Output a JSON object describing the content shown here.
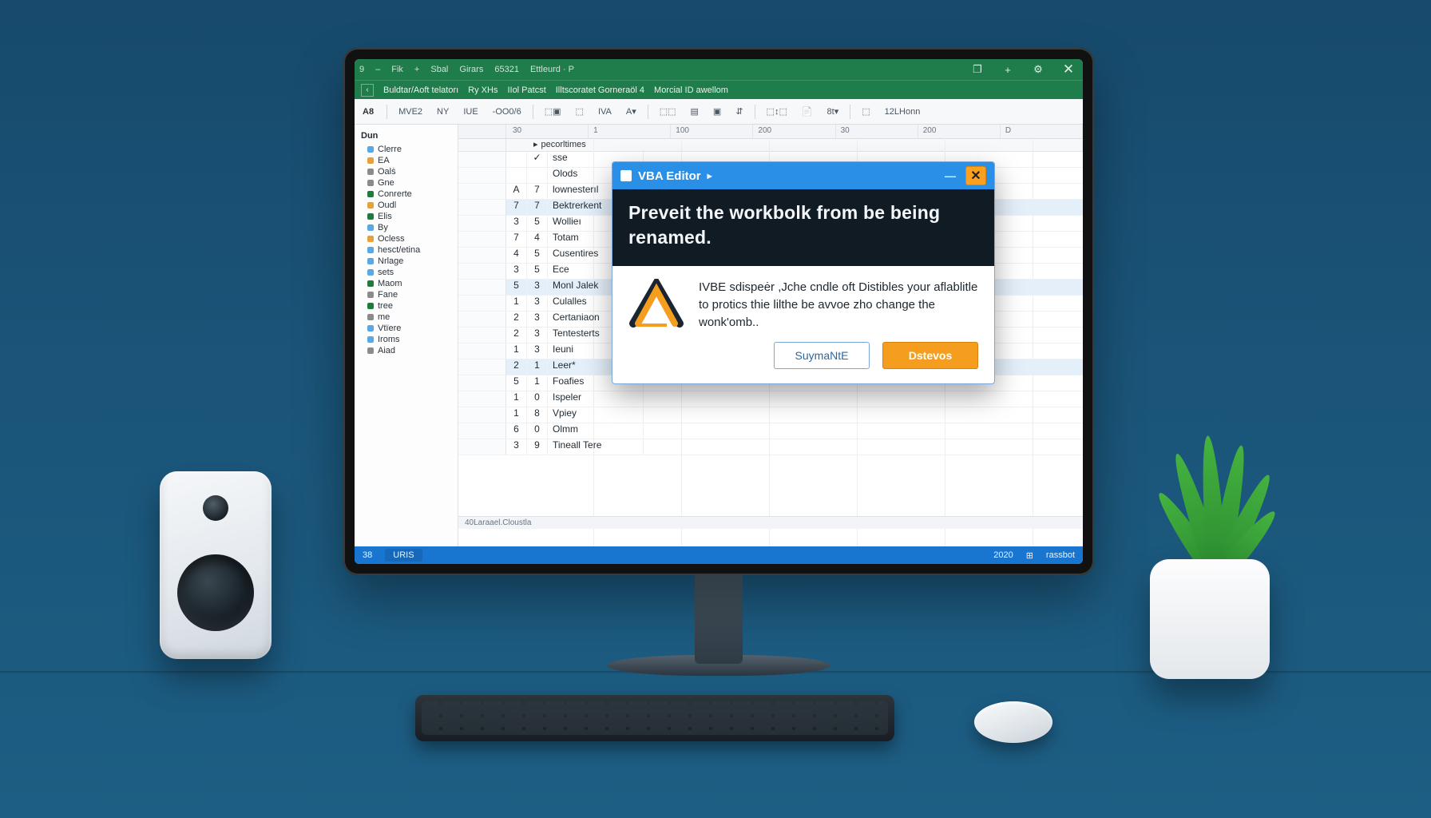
{
  "titlebar": {
    "items": [
      "9",
      "–",
      "Fik",
      "+",
      "Sbal",
      "Girars",
      "65321",
      "Ettleurd · P"
    ],
    "win": {
      "restore": "❐",
      "plus": "+",
      "gear": "⚙",
      "close": "✕"
    }
  },
  "menubar": {
    "items": [
      "Buldtar/Aoft telatorı",
      "Ry XHs",
      "IIol Patcst",
      "Illtscoratet Gorneraöl 4",
      "Morcial ID awellom"
    ]
  },
  "toolbar": {
    "left": "A8",
    "btns": [
      "MVE2",
      "NY",
      "IUE",
      "-OO0/6",
      "⬚▣",
      "⬚",
      "IVA",
      "A▾",
      "⬚⬚",
      "▤",
      "▣",
      "⇵",
      "⬚↕⬚",
      "📄",
      "8t▾",
      "⬚",
      "12LHonn"
    ]
  },
  "left": {
    "head": "Dun",
    "items": [
      {
        "c": "#5aa9e6",
        "t": "Clerre"
      },
      {
        "c": "#e8a13a",
        "t": "EA"
      },
      {
        "c": "#8b8b8b",
        "t": "Oalṡ"
      },
      {
        "c": "#8b8b8b",
        "t": "Gne"
      },
      {
        "c": "#1f7a3e",
        "t": "Conrerte"
      },
      {
        "c": "#e8a13a",
        "t": "Oudl"
      },
      {
        "c": "#1f7a3e",
        "t": "Elis"
      },
      {
        "c": "#5aa9e6",
        "t": "By"
      },
      {
        "c": "#e8a13a",
        "t": "Ocless"
      },
      {
        "c": "#5aa9e6",
        "t": "hesct/etina"
      },
      {
        "c": "#5aa9e6",
        "t": "Nrlage"
      },
      {
        "c": "#5aa9e6",
        "t": "sets"
      },
      {
        "c": "#1f7a3e",
        "t": "Maom"
      },
      {
        "c": "#8b8b8b",
        "t": "Fane"
      },
      {
        "c": "#1f7a3e",
        "t": "tree"
      },
      {
        "c": "#8b8b8b",
        "t": "me"
      },
      {
        "c": "#5aa9e6",
        "t": "Vtïere"
      },
      {
        "c": "#5aa9e6",
        "t": "Iroms"
      },
      {
        "c": "#8b8b8b",
        "t": "Aiad"
      }
    ]
  },
  "ruler": {
    "nums": [
      "30",
      "1",
      "100",
      "200",
      "30",
      "200",
      "D"
    ]
  },
  "grid": {
    "head_label": "pecorltimes",
    "rows": [
      {
        "hl": false,
        "a": "",
        "b": "✓",
        "n": "",
        "t": "sse"
      },
      {
        "hl": false,
        "a": "",
        "b": "",
        "n": "",
        "t": "Olods"
      },
      {
        "hl": false,
        "a": "A",
        "b": "7",
        "n": "",
        "t": "lownesterıl"
      },
      {
        "hl": true,
        "a": "7",
        "b": "7",
        "n": "",
        "t": "Bektrerkent"
      },
      {
        "hl": false,
        "a": "3",
        "b": "5",
        "n": "",
        "t": "Wollieı"
      },
      {
        "hl": false,
        "a": "7",
        "b": "4",
        "n": "",
        "t": "Totam"
      },
      {
        "hl": false,
        "a": "4",
        "b": "5",
        "n": "",
        "t": "Cusentires"
      },
      {
        "hl": false,
        "a": "3",
        "b": "5",
        "n": "",
        "t": "Ece"
      },
      {
        "hl": true,
        "a": "5",
        "b": "3",
        "n": "",
        "t": "Monl Jalek"
      },
      {
        "hl": false,
        "a": "1",
        "b": "3",
        "n": "",
        "t": "Culalles"
      },
      {
        "hl": false,
        "a": "2",
        "b": "3",
        "n": "",
        "t": "Certaniaon"
      },
      {
        "hl": false,
        "a": "2",
        "b": "3",
        "n": "",
        "t": "Tentesterts"
      },
      {
        "hl": false,
        "a": "1",
        "b": "3",
        "n": "",
        "t": "Ieuni"
      },
      {
        "hl": true,
        "a": "2",
        "b": "1",
        "n": "",
        "t": "Leer*"
      },
      {
        "hl": false,
        "a": "5",
        "b": "1",
        "n": "",
        "t": "Foafies"
      },
      {
        "hl": false,
        "a": "1",
        "b": "0",
        "n": "",
        "t": "Ispeler"
      },
      {
        "hl": false,
        "a": "1",
        "b": "8",
        "n": "",
        "t": "Vpiey"
      },
      {
        "hl": false,
        "a": "6",
        "b": "0",
        "n": "",
        "t": "Olmm"
      },
      {
        "hl": false,
        "a": "3",
        "b": "9",
        "n": "",
        "t": "Tineall Tere"
      }
    ],
    "formula": "40Laraael.Cloustla"
  },
  "status": {
    "num": "38",
    "tab": "URIS",
    "right": "2020",
    "pct": "⊞",
    "label": "rassbot"
  },
  "dialog": {
    "title": "VBA Editor",
    "banner": "Preveit the workbolk from be being renamed.",
    "msg": "IVBE sdispeėr ,Jche cndle oft Distibles your aflablitle to protics thie lilthe be avvoe zho change the wonk'omb..",
    "btn1": "SuymaNtE",
    "btn2": "Dstevos",
    "close_glyph": "✕",
    "min_glyph": "—"
  }
}
